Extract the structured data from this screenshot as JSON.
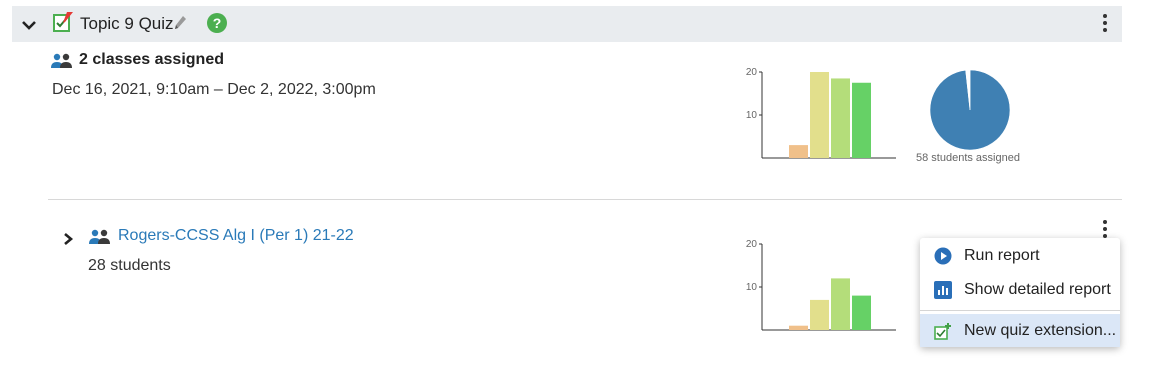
{
  "header": {
    "title": "Topic 9 Quiz",
    "help_label": "?",
    "icons": [
      "chevron-down-icon",
      "quiz-icon",
      "pencil-icon",
      "help-icon",
      "kebab-menu-icon"
    ]
  },
  "summary": {
    "classes_assigned": "2 classes assigned",
    "date_range": "Dec 16, 2021, 9:10am – Dec 2, 2022, 3:00pm",
    "pie_caption": "58 students assigned"
  },
  "class_row": {
    "name": "Rogers-CCSS Alg I (Per 1) 21-22",
    "students": "28 students"
  },
  "menu": {
    "items": [
      {
        "label": "Run report",
        "icon": "play-icon"
      },
      {
        "label": "Show detailed report",
        "icon": "bar-chart-icon"
      },
      {
        "label": "New quiz extension...",
        "icon": "quiz-extension-icon"
      }
    ]
  },
  "colors": {
    "header_bg": "#e9ecef",
    "link": "#2a7ab8",
    "bar_low": "#f0c08a",
    "bar_mid": "#e2df8c",
    "bar_good": "#b4dd7a",
    "bar_best": "#66d166",
    "pie": "#3f80b3",
    "menu_highlight": "#dbe7f7"
  },
  "chart_data": [
    {
      "type": "bar",
      "categories": [
        "",
        "",
        "",
        "",
        ""
      ],
      "values": [
        0,
        3,
        20,
        18.5,
        17.5
      ],
      "ylim": [
        0,
        20
      ],
      "yticks": [
        10,
        20
      ]
    },
    {
      "type": "pie",
      "values": [
        57,
        1
      ],
      "caption": "58 students assigned"
    },
    {
      "type": "bar",
      "categories": [
        "",
        "",
        "",
        "",
        ""
      ],
      "values": [
        0,
        1,
        7,
        12,
        8
      ],
      "ylim": [
        0,
        20
      ],
      "yticks": [
        10,
        20
      ]
    }
  ]
}
